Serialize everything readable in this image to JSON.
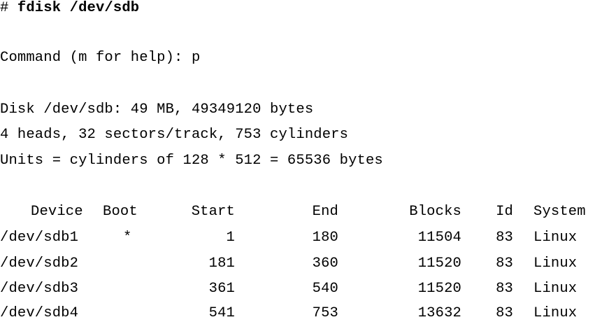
{
  "terminal": {
    "prompt_symbol": "#",
    "command": "fdisk /dev/sdb",
    "command_prompt": "Command (m for help):",
    "command_input": "p",
    "disk_info": "Disk /dev/sdb: 49 MB, 49349120 bytes",
    "geometry": "4 heads, 32 sectors/track, 753 cylinders",
    "units": "Units = cylinders of 128 * 512 = 65536 bytes"
  },
  "partition_table": {
    "headers": {
      "device": "Device",
      "boot": "Boot",
      "start": "Start",
      "end": "End",
      "blocks": "Blocks",
      "id": "Id",
      "system": "System"
    },
    "rows": [
      {
        "device": "/dev/sdb1",
        "boot": "*",
        "start": "1",
        "end": "180",
        "blocks": "11504",
        "id": "83",
        "system": "Linux"
      },
      {
        "device": "/dev/sdb2",
        "boot": "",
        "start": "181",
        "end": "360",
        "blocks": "11520",
        "id": "83",
        "system": "Linux"
      },
      {
        "device": "/dev/sdb3",
        "boot": "",
        "start": "361",
        "end": "540",
        "blocks": "11520",
        "id": "83",
        "system": "Linux"
      },
      {
        "device": "/dev/sdb4",
        "boot": "",
        "start": "541",
        "end": "753",
        "blocks": "13632",
        "id": "83",
        "system": "Linux"
      }
    ]
  }
}
